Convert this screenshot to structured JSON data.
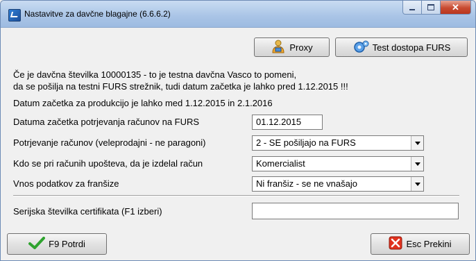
{
  "window": {
    "title": "Nastavitve za davčne blagajne   (6.6.6.2)",
    "close_glyph": "✕"
  },
  "toolbar": {
    "proxy_label": "Proxy",
    "proxy_icon": "proxy-user-icon",
    "test_label": "Test dostopa FURS",
    "test_icon": "gear-network-icon"
  },
  "info": {
    "line1": "Če je davčna številka 10000135 - to je testna davčna Vasco to pomeni,",
    "line2": "da se pošilja na testni FURS strežnik, tudi datum začetka je lahko pred 1.12.2015 !!!",
    "line3": "Datum začetka za produkcijo je lahko med 1.12.2015 in 2.1.2016"
  },
  "form": {
    "start_date_label": "Datuma začetka potrjevanja računov na FURS",
    "start_date_value": "01.12.2015",
    "confirm_label": "Potrjevanje računov (veleprodajni - ne paragoni)",
    "confirm_value": "2 - SE pošiljajo na FURS",
    "issuer_label": "Kdo se pri računih upošteva, da je izdelal račun",
    "issuer_value": "Komercialist",
    "franchise_label": "Vnos podatkov za franšize",
    "franchise_value": "Ni franšiz - se ne vnašajo",
    "cert_label": "Serijska številka certifikata (F1 izberi)",
    "cert_value": ""
  },
  "footer": {
    "confirm_label": "F9 Potrdi",
    "confirm_icon": "checkmark-icon",
    "cancel_label": "Esc Prekini",
    "cancel_icon": "red-x-icon"
  }
}
